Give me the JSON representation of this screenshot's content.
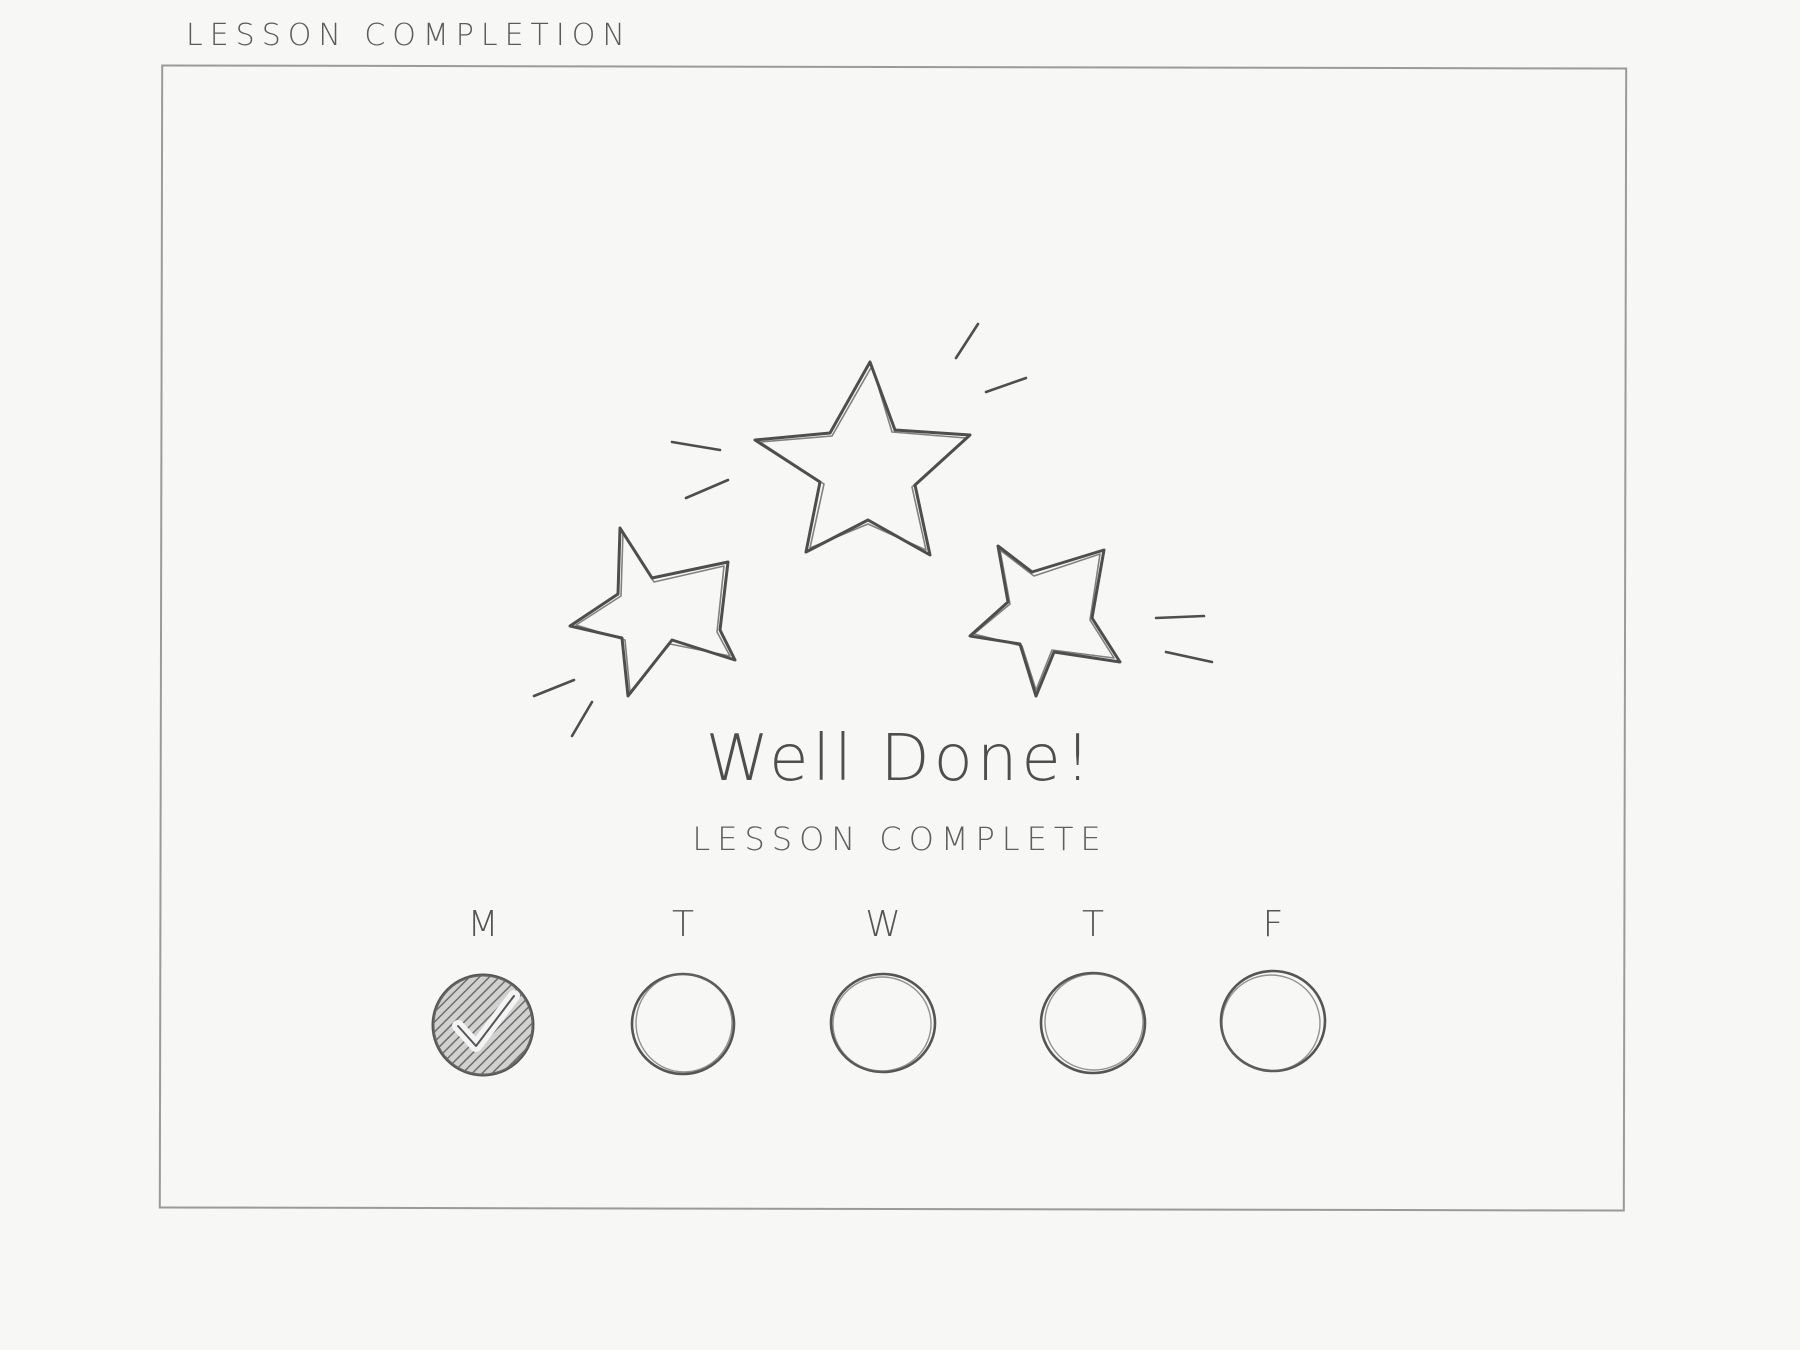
{
  "sheet_title": "LESSON COMPLETION",
  "headline": "Well Done!",
  "subline": "LESSON COMPLETE",
  "rating": {
    "stars_earned": 3,
    "stars_total": 3
  },
  "week": [
    {
      "letter": "M",
      "done": true
    },
    {
      "letter": "T",
      "done": false
    },
    {
      "letter": "W",
      "done": false
    },
    {
      "letter": "T",
      "done": false
    },
    {
      "letter": "F",
      "done": false
    }
  ],
  "colors": {
    "ink": "#555555",
    "frame": "#9a9a9a",
    "paper": "#f7f7f6",
    "done_fill": "#6a6a6a"
  },
  "icons": {
    "star": "star-icon",
    "check": "checkmark-icon",
    "empty": "empty-circle-icon"
  }
}
